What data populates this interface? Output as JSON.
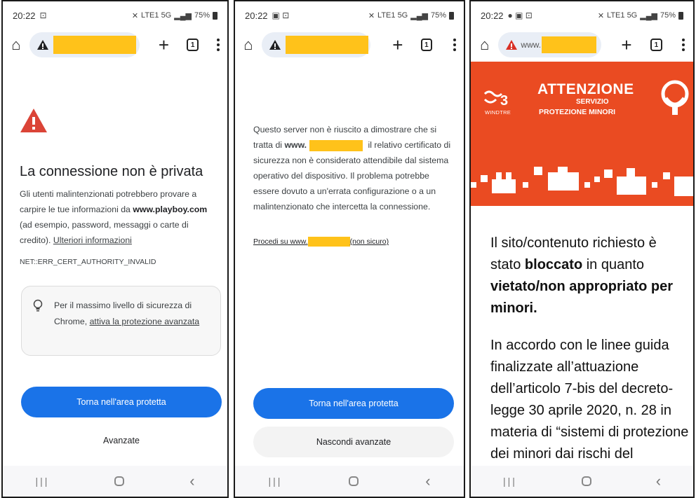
{
  "colors": {
    "primary_button": "#1a73e8",
    "warning_red": "#db4437",
    "banner_orange": "#ea4b22",
    "redaction_yellow": "#ffc21a"
  },
  "status": {
    "time": "20:22",
    "network": "LTE1 5G",
    "battery": "75%"
  },
  "panel1": {
    "title": "La connessione non è privata",
    "body_part1": "Gli utenti malintenzionati potrebbero provare a carpire le tue informazioni da ",
    "body_domain": "www.playboy.com",
    "body_part2": " (ad esempio, password, messaggi o carte di credito). ",
    "more_info_link": "Ulteriori informazioni",
    "error_code": "NET::ERR_CERT_AUTHORITY_INVALID",
    "tip_text": "Per il massimo livello di sicurezza di Chrome, ",
    "tip_link": "attiva la protezione avanzata",
    "back_button": "Torna nell'area protetta",
    "advanced_button": "Avanzate"
  },
  "panel2": {
    "body_part1": "Questo server non è riuscito a dimostrare che si tratta di ",
    "body_domain": "www.",
    "body_part2": " il relativo certificato di sicurezza non è considerato attendibile dal sistema operativo del dispositivo. Il problema potrebbe essere dovuto a un'errata configurazione o a un malintenzionato che intercetta la connessione.",
    "proceed_prefix": "Procedi su www.",
    "proceed_suffix": "(non sicuro)",
    "back_button": "Torna nell'area protetta",
    "hide_advanced_button": "Nascondi avanzate"
  },
  "panel3": {
    "url_prefix": "www.",
    "brand_label": "WINDTRE",
    "banner_title": "ATTENZIONE",
    "banner_subtitle1": "SERVIZIO",
    "banner_subtitle2": "PROTEZIONE MINORI",
    "text1_part1": "Il sito/contenuto richiesto è stato ",
    "text1_bold1": "bloccato",
    "text1_part2": " in quanto ",
    "text1_bold2": "vietato/non appropriato per minori.",
    "text2": "In accordo con le linee guida finalizzate all’attuazione dell’articolo 7-bis del decreto-legge 30 aprile 2020, n. 28 in materia di “sistemi di protezione dei minori dai rischi del"
  }
}
